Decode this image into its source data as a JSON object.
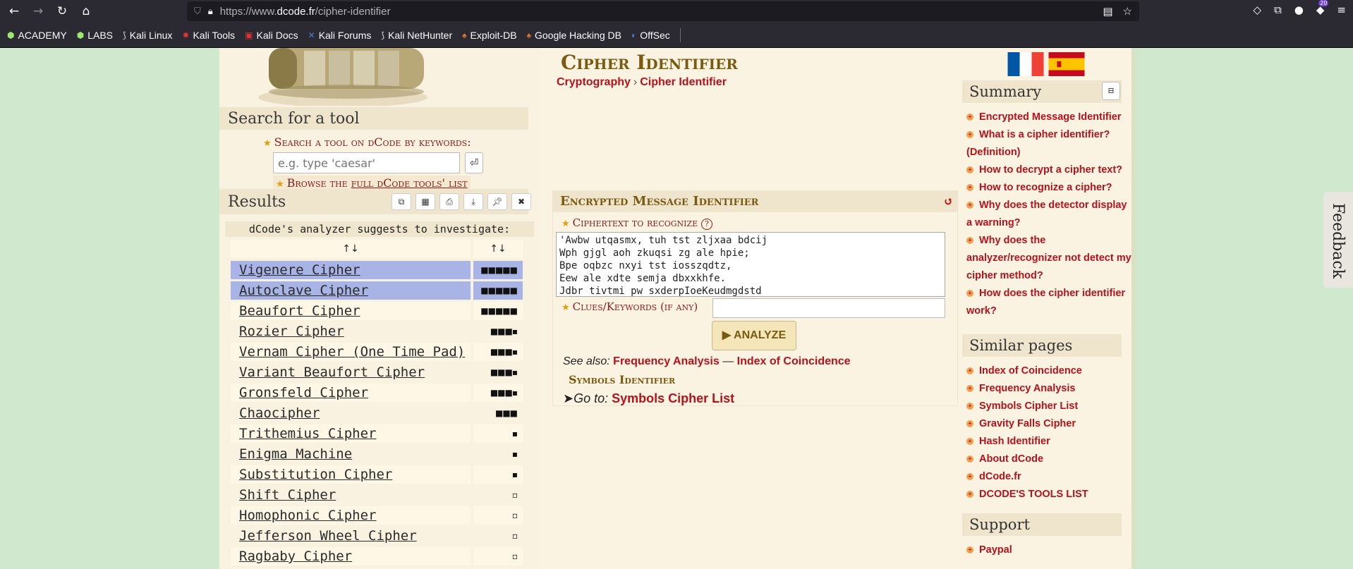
{
  "browser": {
    "url_prefix": "https://www.",
    "url_domain": "dcode.fr",
    "url_path": "/cipher-identifier",
    "notification_count": "20"
  },
  "bookmarks": [
    "ACADEMY",
    "LABS",
    "Kali Linux",
    "Kali Tools",
    "Kali Docs",
    "Kali Forums",
    "Kali NetHunter",
    "Exploit-DB",
    "Google Hacking DB",
    "OffSec"
  ],
  "left": {
    "search_title": "Search for a tool",
    "search_keywords_label": "Search a tool on dCode by keywords:",
    "search_placeholder": "e.g. type 'caesar'",
    "browse_prefix": "Browse the ",
    "browse_link": "full dCode tools' list",
    "results_title": "Results",
    "suggest": "dCode's analyzer suggests to investigate:",
    "col1": "↑↓",
    "col2": "↑↓",
    "results": [
      {
        "name": "Vigenere Cipher",
        "score": "■■■■■",
        "selected": true
      },
      {
        "name": "Autoclave Cipher",
        "score": "■■■■■",
        "selected": true
      },
      {
        "name": "Beaufort Cipher",
        "score": "■■■■■",
        "selected": false
      },
      {
        "name": "Rozier Cipher",
        "score": "■■■▪",
        "selected": false
      },
      {
        "name": "Vernam Cipher (One Time Pad)",
        "score": "■■■▪",
        "selected": false
      },
      {
        "name": "Variant Beaufort Cipher",
        "score": "■■■▪",
        "selected": false
      },
      {
        "name": "Gronsfeld Cipher",
        "score": "■■■▪",
        "selected": false
      },
      {
        "name": "Chaocipher",
        "score": "■■■",
        "selected": false
      },
      {
        "name": "Trithemius Cipher",
        "score": "▪",
        "selected": false
      },
      {
        "name": "Enigma Machine",
        "score": "▪",
        "selected": false
      },
      {
        "name": "Substitution Cipher",
        "score": "▪",
        "selected": false
      },
      {
        "name": "Shift Cipher",
        "score": "▫",
        "selected": false
      },
      {
        "name": "Homophonic Cipher",
        "score": "▫",
        "selected": false
      },
      {
        "name": "Jefferson Wheel Cipher",
        "score": "▫",
        "selected": false
      },
      {
        "name": "Ragbaby Cipher",
        "score": "▫",
        "selected": false
      }
    ]
  },
  "main": {
    "title": "Cipher Identifier",
    "crumb_1": "Cryptography",
    "crumb_sep": "›",
    "crumb_2": "Cipher Identifier",
    "panel_title": "Encrypted Message Identifier",
    "ciphertext_label": "Ciphertext to recognize",
    "ciphertext": "'Awbw utqasmx, tuh tst zljxaa bdcij\nWph gjgl aoh zkuqsi zg ale hpie;\nBpe oqbzc nxyi tst iosszqdtz,\nEew ale xdte semja dbxxkhfe.\nJdbr tivtmi pw sxderpIoeKeudmgdstd",
    "clues_label": "Clues/Keywords (if any)",
    "analyze": "▶ ANALYZE",
    "see_also": "See also:",
    "see_also_1": "Frequency Analysis",
    "see_also_dash": " — ",
    "see_also_2": "Index of Coincidence",
    "symbols_identifier": "Symbols Identifier",
    "goto_label": "Go to:",
    "goto_link": "Symbols Cipher List"
  },
  "right": {
    "summary_title": "Summary",
    "summary": [
      "Encrypted Message Identifier",
      "What is a cipher identifier? (Definition)",
      "How to decrypt a cipher text?",
      "How to recognize a cipher?",
      "Why does the detector display a warning?",
      "Why does the analyzer/recognizer not detect my cipher method?",
      "How does the cipher identifier work?"
    ],
    "similar_title": "Similar pages",
    "similar": [
      "Index of Coincidence",
      "Frequency Analysis",
      "Symbols Cipher List",
      "Gravity Falls Cipher",
      "Hash Identifier",
      "About dCode",
      "dCode.fr",
      "DCODE'S TOOLS LIST"
    ],
    "support_title": "Support",
    "support": [
      "Paypal"
    ]
  },
  "feedback": "Feedback"
}
